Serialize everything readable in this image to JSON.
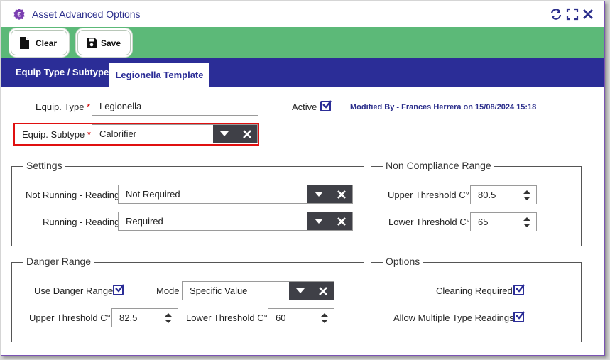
{
  "window": {
    "title": "Asset Advanced Options"
  },
  "toolbar": {
    "clear_label": "Clear",
    "save_label": "Save"
  },
  "tabs": [
    {
      "label": "Equip Type / Subtype"
    },
    {
      "label": "Legionella Template"
    }
  ],
  "form": {
    "equip_type_label": "Equip. Type",
    "equip_type_value": "Legionella",
    "required_marker": "*",
    "active_label": "Active",
    "modified_by": "Modified By -  Frances Herrera on 15/08/2024 15:18",
    "equip_subtype_label": "Equip. Subtype",
    "equip_subtype_value": "Calorifier"
  },
  "settings": {
    "legend": "Settings",
    "not_running_label": "Not Running - Reading",
    "not_running_value": "Not Required",
    "running_label": "Running - Reading",
    "running_value": "Required"
  },
  "non_compliance": {
    "legend": "Non Compliance Range",
    "upper_label": "Upper Threshold C°",
    "upper_value": "80.5",
    "lower_label": "Lower Threshold C°",
    "lower_value": "65"
  },
  "danger": {
    "legend": "Danger Range",
    "use_label": "Use Danger Range",
    "mode_label": "Mode",
    "mode_value": "Specific Value",
    "upper_label": "Upper Threshold C°",
    "upper_value": "82.5",
    "lower_label": "Lower Threshold C°",
    "lower_value": "60"
  },
  "options": {
    "legend": "Options",
    "cleaning_label": "Cleaning Required",
    "multiple_label": "Allow Multiple Type Readings"
  },
  "colors": {
    "brand": "#2b2d97",
    "toolbar": "#5cb978",
    "required": "#d10000",
    "highlight": "#e01010"
  }
}
